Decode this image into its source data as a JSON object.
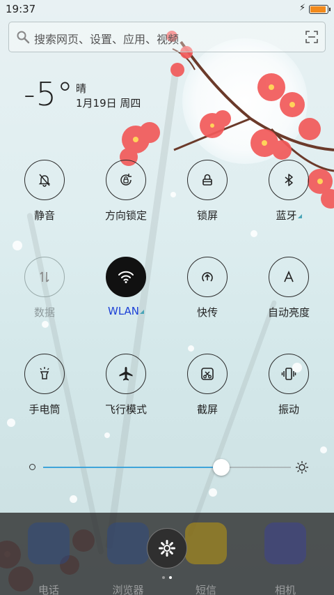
{
  "status_bar": {
    "time": "19:37",
    "battery_level": 1.0,
    "charging": true
  },
  "search": {
    "placeholder": "搜索网页、设置、应用、视频"
  },
  "weather": {
    "temperature": "-5°",
    "condition": "晴",
    "date": "1月19日 周四"
  },
  "toggles": [
    {
      "label": "静音",
      "icon": "bell-off-icon",
      "state": "off"
    },
    {
      "label": "方向锁定",
      "icon": "rotation-lock-icon",
      "state": "off"
    },
    {
      "label": "锁屏",
      "icon": "lock-icon",
      "state": "off"
    },
    {
      "label": "蓝牙",
      "icon": "bluetooth-icon",
      "state": "off",
      "expandable": true
    },
    {
      "label": "数据",
      "icon": "mobile-data-icon",
      "state": "disabled"
    },
    {
      "label": "WLAN",
      "icon": "wifi-icon",
      "state": "on",
      "expandable": true
    },
    {
      "label": "快传",
      "icon": "quick-transfer-icon",
      "state": "off"
    },
    {
      "label": "自动亮度",
      "icon": "auto-brightness-icon",
      "state": "off"
    },
    {
      "label": "手电筒",
      "icon": "flashlight-icon",
      "state": "off"
    },
    {
      "label": "飞行模式",
      "icon": "airplane-icon",
      "state": "off"
    },
    {
      "label": "截屏",
      "icon": "screenshot-icon",
      "state": "off"
    },
    {
      "label": "振动",
      "icon": "vibrate-icon",
      "state": "off"
    }
  ],
  "brightness": {
    "level": 0.72
  },
  "dock": {
    "apps": [
      {
        "label": "电话",
        "icon": "phone-icon",
        "color": "#2a4a8a"
      },
      {
        "label": "浏览器",
        "icon": "browser-icon",
        "color": "#2a4a8a"
      },
      {
        "label": "短信",
        "icon": "message-icon",
        "color": "#d8a800"
      },
      {
        "label": "相机",
        "icon": "camera-icon",
        "color": "#3a3fa0"
      }
    ],
    "page_count": 2,
    "active_page": 2
  },
  "colors": {
    "accent": "#3fa4d9",
    "wlan_label": "#1b3fd6",
    "battery": "#f28a1c"
  }
}
